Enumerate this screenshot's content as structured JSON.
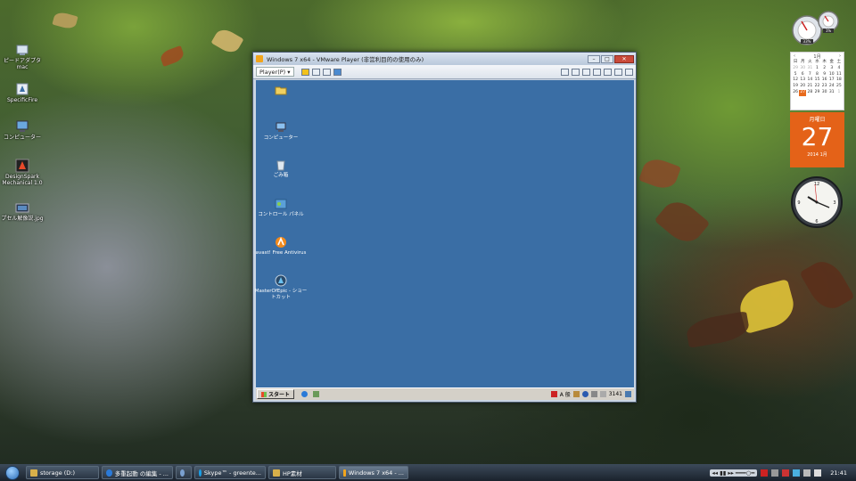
{
  "desktop_icons": [
    {
      "label": "ピードアダプタ\nmac",
      "icon": "network-adapter-icon"
    },
    {
      "label": "SpecificFire",
      "icon": "specificfire-icon"
    },
    {
      "label": "コンピューター",
      "icon": "computer-icon"
    },
    {
      "label": "DesignSpark\nMechanical 1.0",
      "icon": "designspark-icon"
    },
    {
      "label": "プセル解像説.jpg",
      "icon": "image-file-icon"
    }
  ],
  "gadgets": {
    "meter_labels": [
      "33%",
      "1%"
    ],
    "calendar": {
      "month_header": "1月",
      "weekdays": [
        "日",
        "月",
        "火",
        "水",
        "木",
        "金",
        "土"
      ],
      "rows": [
        [
          "29",
          "30",
          "31",
          "1",
          "2",
          "3",
          "4"
        ],
        [
          "5",
          "6",
          "7",
          "8",
          "9",
          "10",
          "11"
        ],
        [
          "12",
          "13",
          "14",
          "15",
          "16",
          "17",
          "18"
        ],
        [
          "19",
          "20",
          "21",
          "22",
          "23",
          "24",
          "25"
        ],
        [
          "26",
          "27",
          "28",
          "29",
          "30",
          "31",
          "1"
        ]
      ],
      "dow": "月曜日",
      "day": "27",
      "year_month": "2014 1月"
    }
  },
  "vm": {
    "title": "Windows 7 x64 - VMware Player (非営利目的の使用のみ)",
    "player_menu": "Player(P)",
    "guest_icons": [
      {
        "label": "",
        "icon": "folder-icon"
      },
      {
        "label": "コンピューター",
        "icon": "computer-icon"
      },
      {
        "label": "ごみ箱",
        "icon": "recycle-bin-icon"
      },
      {
        "label": "コントロール パネル",
        "icon": "control-panel-icon"
      },
      {
        "label": "avast! Free Antivirus",
        "icon": "avast-icon"
      },
      {
        "label": "MasterOfEpic - ショートカット",
        "icon": "masterofepic-icon"
      }
    ],
    "guest_taskbar": {
      "start": "スタート",
      "ime": "A 般",
      "clock": "3141"
    }
  },
  "taskbar": {
    "items": [
      {
        "label": "storage (D:)",
        "active": false,
        "color": "#d8b04a"
      },
      {
        "label": "多重起動 の編集 - ...",
        "active": false,
        "color": "#2a7ad8"
      },
      {
        "label": "",
        "active": false,
        "color": "#7aa0d0"
      },
      {
        "label": "Skype™ - greente...",
        "active": false,
        "color": "#1aa0e8"
      },
      {
        "label": "HP素材",
        "active": false,
        "color": "#d8b04a"
      },
      {
        "label": "Windows 7 x64 - ...",
        "active": true,
        "color": "#f2a51c"
      }
    ],
    "clock": "21:41"
  }
}
